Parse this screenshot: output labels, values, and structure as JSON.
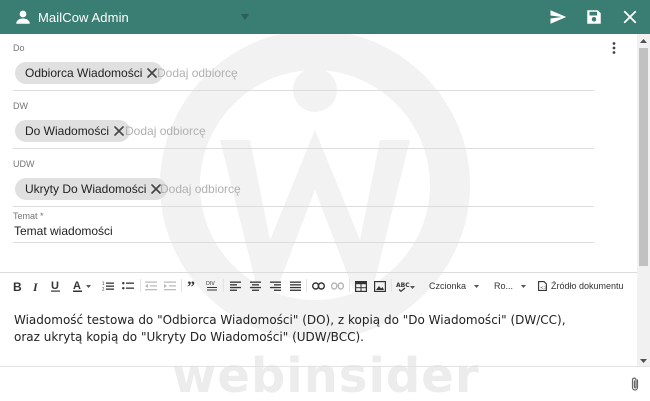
{
  "titlebar": {
    "account_name": "MailCow Admin",
    "color": "#3a7d72",
    "icons": [
      "account-icon",
      "caret-down-icon",
      "send-icon",
      "save-icon",
      "close-icon"
    ]
  },
  "fields": {
    "to": {
      "label": "Do",
      "chip": "Odbiorca Wiadomości",
      "placeholder": "Dodaj odbiorcę"
    },
    "cc": {
      "label": "DW",
      "chip": "Do Wiadomości",
      "placeholder": "Dodaj odbiorcę"
    },
    "bcc": {
      "label": "UDW",
      "chip": "Ukryty Do Wiadomości",
      "placeholder": "Dodaj odbiorcę"
    },
    "subject": {
      "label": "Temat *",
      "value": "Temat wiadomości"
    }
  },
  "toolbar": {
    "font_combo": "Czcionka",
    "size_combo": "Ro...",
    "source_label": "Źródło dokumentu"
  },
  "message": {
    "line1": "Wiadomość testowa do \"Odbiorca Wiadomości\" (DO), z kopią do \"Do Wiadomości\" (DW/CC),",
    "line2": "oraz ukrytą kopią do \"Ukryty Do Wiadomości\" (UDW/BCC)."
  },
  "watermark": {
    "text": "webinsider"
  }
}
